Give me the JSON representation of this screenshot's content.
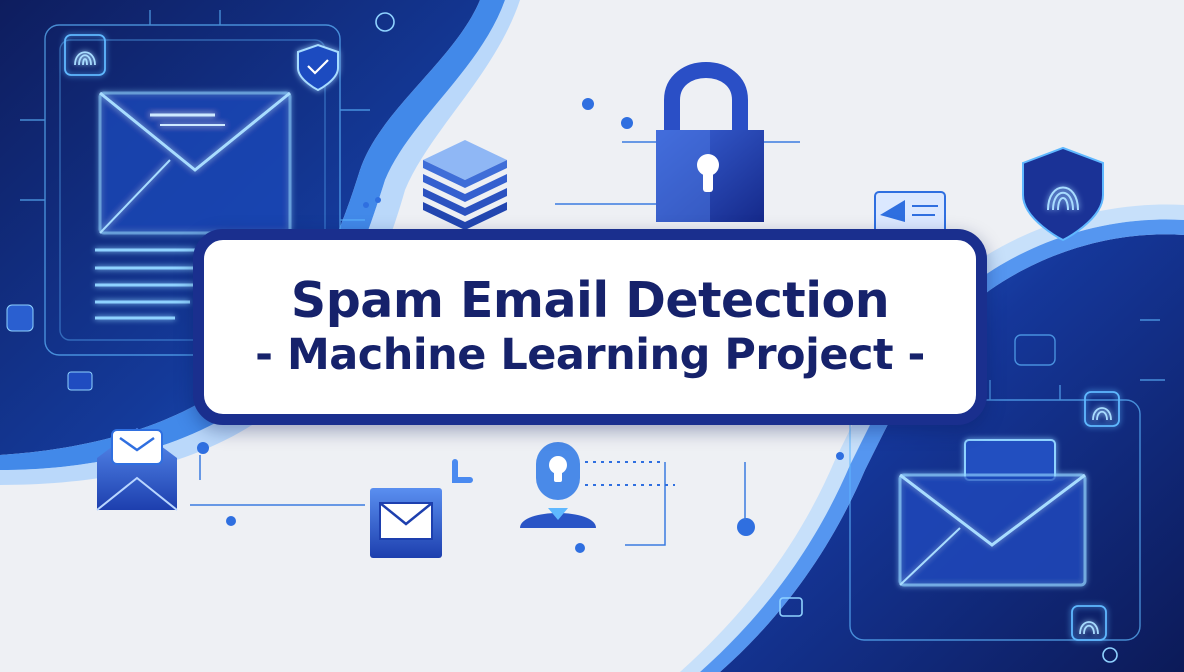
{
  "title": {
    "line1": "Spam Email Detection",
    "line2": "- Machine Learning Project -"
  },
  "colors": {
    "background": "#eef0f4",
    "navy": "#0f1e6e",
    "accent_blue": "#2f6fe0",
    "glow": "#5fb8ff",
    "title_border": "#1a2f8e",
    "title_text": "#16226b"
  },
  "icons": [
    "envelope-icon",
    "padlock-icon",
    "database-stack-icon",
    "shield-fingerprint-icon",
    "fingerprint-icon",
    "user-icon",
    "network-line-icon"
  ]
}
